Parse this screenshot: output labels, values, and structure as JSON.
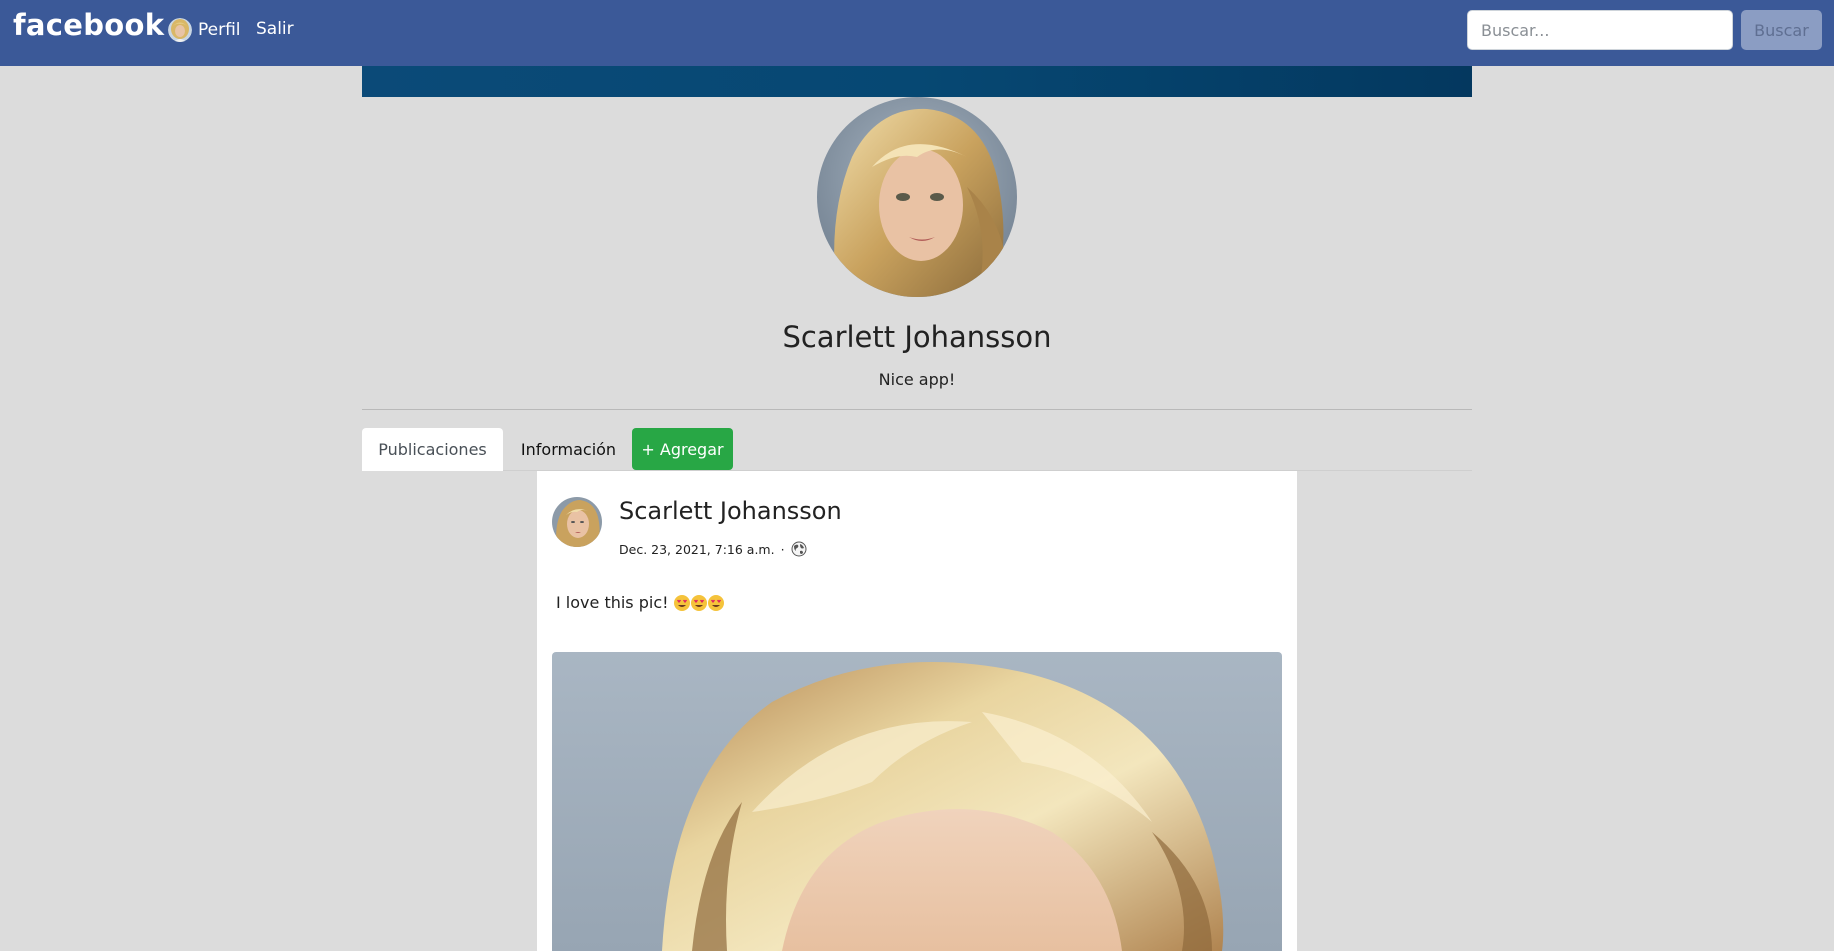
{
  "navbar": {
    "brand": "facebook",
    "profile_label": "Perfil",
    "logout_label": "Salir",
    "search_placeholder": "Buscar...",
    "search_button": "Buscar",
    "brand_color": "#3b5998"
  },
  "profile": {
    "name": "Scarlett Johansson",
    "bio": "Nice app!",
    "cover_color": "#064873"
  },
  "tabs": {
    "items": [
      {
        "label": "Publicaciones",
        "active": true
      },
      {
        "label": "Información",
        "active": false
      }
    ],
    "add_button": "+ Agregar",
    "add_button_color": "#28a745"
  },
  "post": {
    "author": "Scarlett Johansson",
    "date": "Dec. 23, 2021, 7:16 a.m.",
    "separator": "·",
    "privacy_icon": "globe-icon",
    "text": "I love this pic!",
    "emojis": [
      "heart-eyes-emoji",
      "heart-eyes-emoji",
      "heart-eyes-emoji"
    ]
  }
}
